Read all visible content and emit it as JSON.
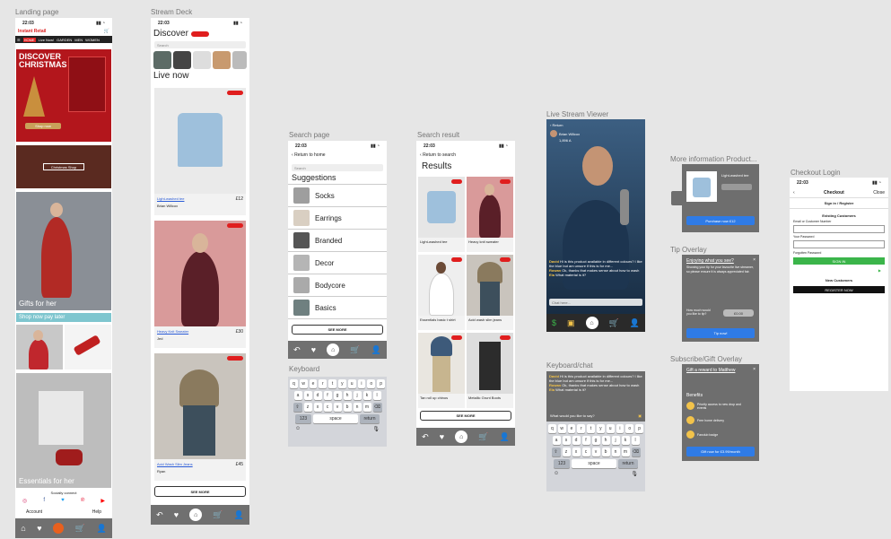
{
  "labels": {
    "landing": "Landing page",
    "stream_deck": "Stream Deck",
    "search_page": "Search page",
    "search_result": "Search result",
    "live_viewer": "Live Stream Viewer",
    "more_info": "More information Product...",
    "checkout": "Checkout Login",
    "keyboard": "Keyboard",
    "keyboard_chat": "Keyboard/chat",
    "tip_overlay": "Tip Overlay",
    "subscribe_overlay": "Subscribe/Gift Overlay"
  },
  "time": "22:03",
  "landing": {
    "brand": "Instant Retail",
    "nav": [
      "HOME",
      "Live Now!",
      "GARDEN",
      "MEN",
      "WOMEN",
      "LOCATE"
    ],
    "hero": "DISCOVER CHRISTMAS",
    "hero_btn": "Shop now",
    "banner2": "Christmas Shop",
    "gifts": "Gifts for her",
    "shop_now": "Shop now pay later",
    "essentials": "Essentials for her",
    "socially": "Socially connect",
    "account": "Account",
    "help": "Help"
  },
  "deck": {
    "title": "Discover",
    "search": "Search",
    "live_now": "Live now",
    "items": [
      {
        "name": "Light-washed tee",
        "price": "£12",
        "seller": "Brian Willcox"
      },
      {
        "name": "Heavy Knit Sweater",
        "price": "£30",
        "seller": "Jed"
      },
      {
        "name": "Acid Wash Slim Jeans",
        "price": "£45",
        "seller": "Ryan"
      }
    ],
    "see_more": "SEE MORE"
  },
  "search": {
    "back": "Return to home",
    "placeholder": "Search",
    "heading": "Suggestions",
    "items": [
      "Socks",
      "Earrings",
      "Branded",
      "Decor",
      "Bodycore",
      "Basics"
    ],
    "see_more": "SEE MORE"
  },
  "results": {
    "back": "Return to search",
    "heading": "Results",
    "items": [
      "Light-washed tee",
      "Heavy knit sweater",
      "Essentials basic t shirt",
      "Acid wash slim jeans",
      "Tan roll up chinos",
      "Metallic Grunt Boots"
    ],
    "see_more": "SEE MORE"
  },
  "viewer": {
    "back": "Return",
    "host": "Brian Willcox",
    "viewers": "1,896 A",
    "chat": [
      {
        "user": "David",
        "text": "Hi is this product available in different colours? I like the blue but am unsure if this is for me..."
      },
      {
        "user": "Rowan",
        "text": "Ok, thanks that makes sense about how to wash"
      },
      {
        "user": "Ela",
        "text": "What material is it?"
      }
    ],
    "chat_placeholder": "Chat here..."
  },
  "chat_screen": {
    "placeholder": "What would you like to say?",
    "space": "space",
    "return": "return",
    "num": "123"
  },
  "more_info": {
    "product": "Light-washed tee",
    "button": "Purchase now £12"
  },
  "tip": {
    "title": "Enjoying what you see?",
    "body": "Showing your tip for your favourite live streamer, so please ensure it is always appreciated fair.",
    "amount_label": "How much would you like to tip?",
    "amount": "£0.00",
    "button": "Tip now!"
  },
  "subscribe": {
    "title": "Gift a reward to Matthew",
    "benefits": "Benefits",
    "b1": "Priority access to new drop and events",
    "b2": "Free home delivery",
    "b3": "Fanclub badge",
    "button": "Gift now for £3.99/month"
  },
  "checkout": {
    "title": "Checkout",
    "close": "Close",
    "tab": "Sign in / Register",
    "existing": "Existing Customers",
    "email": "Email or Customer Number",
    "password": "Your Password",
    "forgot": "Forgotten Password",
    "sign_in": "SIGN IN",
    "new": "New Customers",
    "register": "REGISTER NOW"
  },
  "keys": {
    "row1": [
      "q",
      "w",
      "e",
      "r",
      "t",
      "y",
      "u",
      "i",
      "o",
      "p"
    ],
    "row2": [
      "a",
      "s",
      "d",
      "f",
      "g",
      "h",
      "j",
      "k",
      "l"
    ],
    "row3": [
      "z",
      "x",
      "c",
      "v",
      "b",
      "n",
      "m"
    ]
  },
  "colors": {
    "accent": "#e01e1e",
    "blue": "#2f7be6",
    "green": "#3bb54a",
    "nav": "#707070"
  }
}
